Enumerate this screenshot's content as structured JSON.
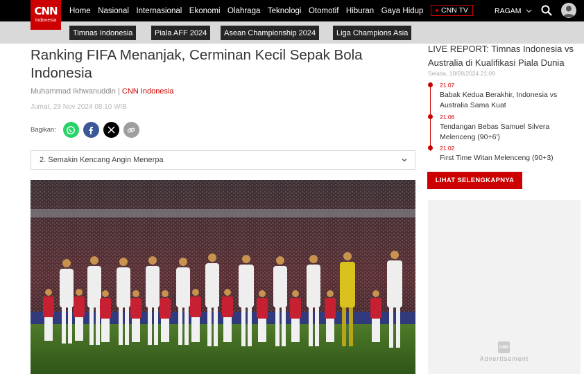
{
  "header": {
    "logo_text": "CNN",
    "logo_sub": "Indonesia",
    "nav_items": [
      "Home",
      "Nasional",
      "Internasional",
      "Ekonomi",
      "Olahraga",
      "Teknologi",
      "Otomotif",
      "Hiburan",
      "Gaya Hidup"
    ],
    "cnn_tv": "CNN TV",
    "ragam": "RAGAM"
  },
  "subnav": {
    "tags": [
      "Timnas Indonesia",
      "Piala AFF 2024",
      "Asean Championship 2024",
      "Liga Champions Asia"
    ]
  },
  "article": {
    "title": "Ranking FIFA Menanjak, Cerminan Kecil Sepak Bola Indonesia",
    "author": "Muhammad Ikhwanuddin",
    "separator": " | ",
    "source": "CNN Indonesia",
    "date": "Jumat, 29 Nov 2024 08:10 WIB",
    "share_label": "Bagikan:",
    "share_icons": [
      "whatsapp-icon",
      "facebook-icon",
      "x-icon",
      "link-icon"
    ],
    "section_select": "2. Semakin Kencang Angin Menerpa"
  },
  "sidebar": {
    "live_title": "LIVE REPORT: Timnas Indonesia vs Australia di Kualifikasi Piala Dunia",
    "live_date": "Selasa, 10/09/2024 21:09",
    "items": [
      {
        "time": "21:07",
        "text": "Babak Kedua Berakhir, Indonesia vs Australia Sama Kuat"
      },
      {
        "time": "21:06",
        "text": "Tendangan Bebas Samuel Silvera Melenceng (90+6')"
      },
      {
        "time": "21:02",
        "text": "First Time Witan Melenceng (90+3)"
      }
    ],
    "more_button": "LIHAT SELENGKAPNYA",
    "ad_label": "Advertisement",
    "ad_logo": "CNN"
  },
  "colors": {
    "brand_red": "#cc0000",
    "whatsapp": "#25d366",
    "facebook": "#3b5998",
    "x": "#000000",
    "link": "#9e9e9e"
  }
}
